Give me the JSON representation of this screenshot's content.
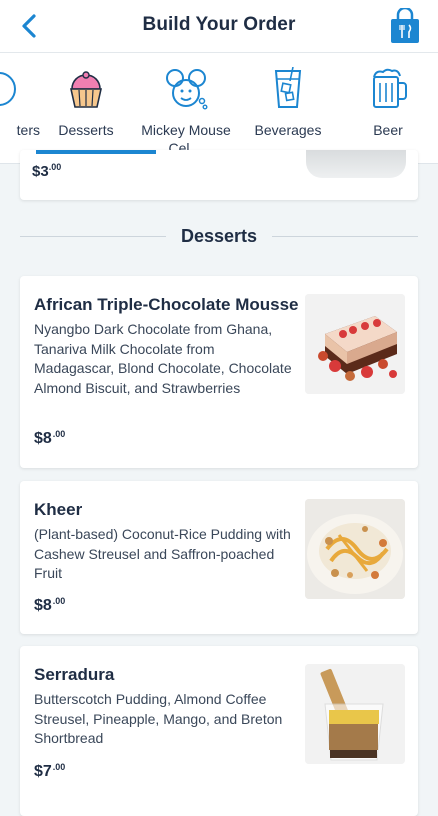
{
  "header": {
    "title": "Build Your Order"
  },
  "categories": [
    {
      "label": "ters",
      "icon": "cup-icon"
    },
    {
      "label": "Desserts",
      "icon": "cupcake-icon"
    },
    {
      "label": "Mickey Mouse Cel…",
      "icon": "mickey-icon"
    },
    {
      "label": "Beverages",
      "icon": "glass-icon"
    },
    {
      "label": "Beer",
      "icon": "beer-mug-icon"
    }
  ],
  "partial_item": {
    "price_main": "$3"
  },
  "section": {
    "title": "Desserts"
  },
  "items": [
    {
      "name": "African Triple-Chocolate Mousse",
      "description": "Nyangbo Dark Chocolate from Ghana, Tanariva Milk Chocolate from Madagascar, Blond Chocolate, Chocolate Almond Biscuit, and Strawberries",
      "price_main": "$8",
      "price_cents": ".00"
    },
    {
      "name": "Kheer",
      "description": "(Plant-based) Coconut-Rice Pudding with Cashew Streusel and Saffron-poached Fruit",
      "price_main": "$8",
      "price_cents": ".00"
    },
    {
      "name": "Serradura",
      "description": "Butterscotch Pudding, Almond Coffee Streusel, Pineapple, Mango, and Breton Shortbread",
      "price_main": "$7",
      "price_cents": ".00"
    }
  ],
  "colors": {
    "accent": "#1c86d1",
    "dessert_pink": "#f07fb1",
    "text_dark": "#1f2d44"
  }
}
